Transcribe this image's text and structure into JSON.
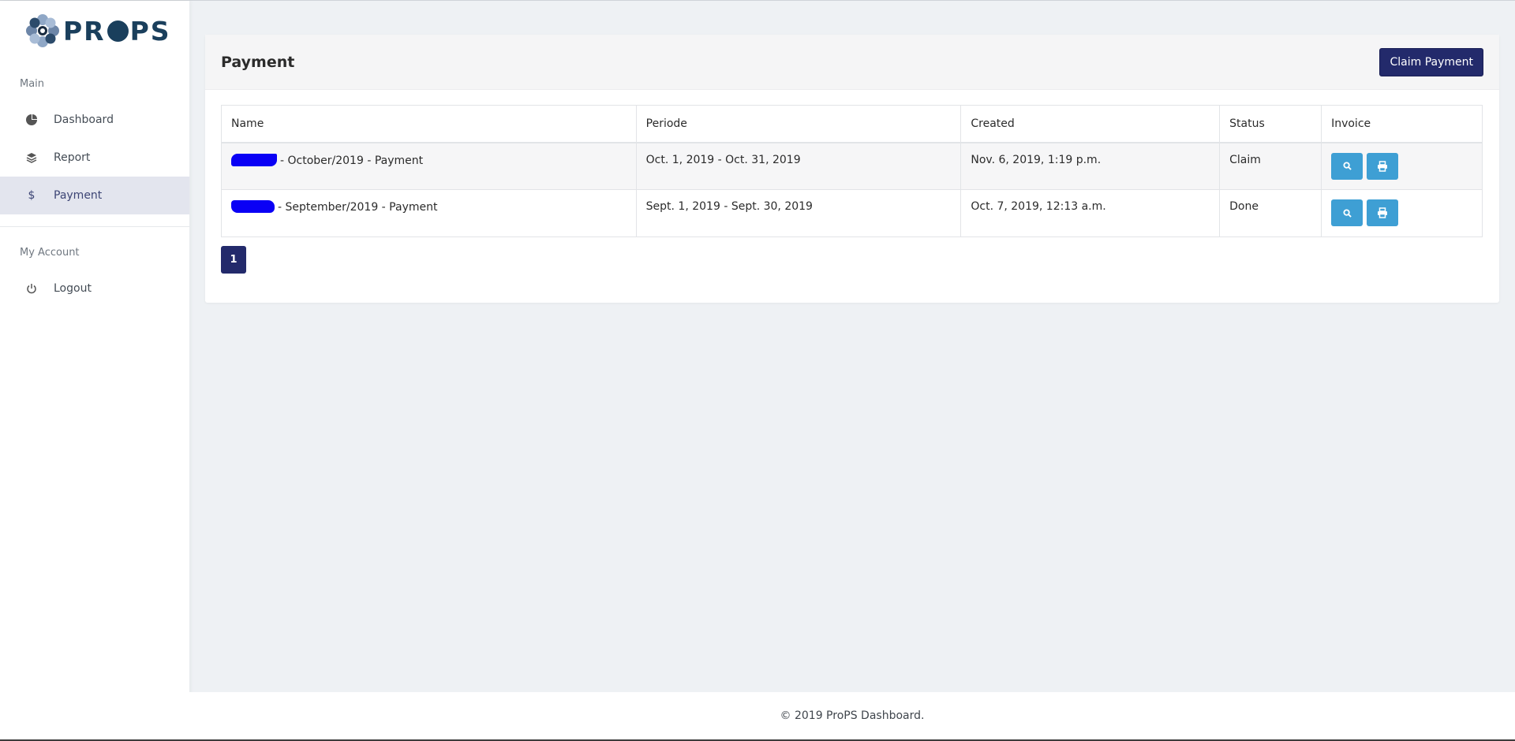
{
  "brand": {
    "name": "PROPS",
    "accent": "#232a6b",
    "logo_color": "#1a3f5c"
  },
  "sidebar": {
    "sections": [
      {
        "title": "Main"
      },
      {
        "title": "My Account"
      }
    ],
    "items": [
      {
        "label": "Dashboard",
        "icon": "pie-chart-icon"
      },
      {
        "label": "Report",
        "icon": "layers-icon"
      },
      {
        "label": "Payment",
        "icon": "dollar-icon",
        "active": true
      },
      {
        "label": "Logout",
        "icon": "power-icon"
      }
    ]
  },
  "card": {
    "title": "Payment",
    "claim_button": "Claim Payment",
    "columns": [
      "Name",
      "Periode",
      "Created",
      "Status",
      "Invoice"
    ],
    "rows": [
      {
        "name": "- October/2019 - Payment",
        "periode": "Oct. 1, 2019 - Oct. 31, 2019",
        "created": "Nov. 6, 2019, 1:19 p.m.",
        "status": "Claim"
      },
      {
        "name": "- September/2019 - Payment",
        "periode": "Sept. 1, 2019 - Sept. 30, 2019",
        "created": "Oct. 7, 2019, 12:13 a.m.",
        "status": "Done"
      }
    ],
    "pagination": {
      "current": "1"
    }
  },
  "footer": {
    "text": "© 2019 ProPS Dashboard."
  },
  "colors": {
    "action_button": "#3e9fd4",
    "redaction": "#0a00f5"
  }
}
